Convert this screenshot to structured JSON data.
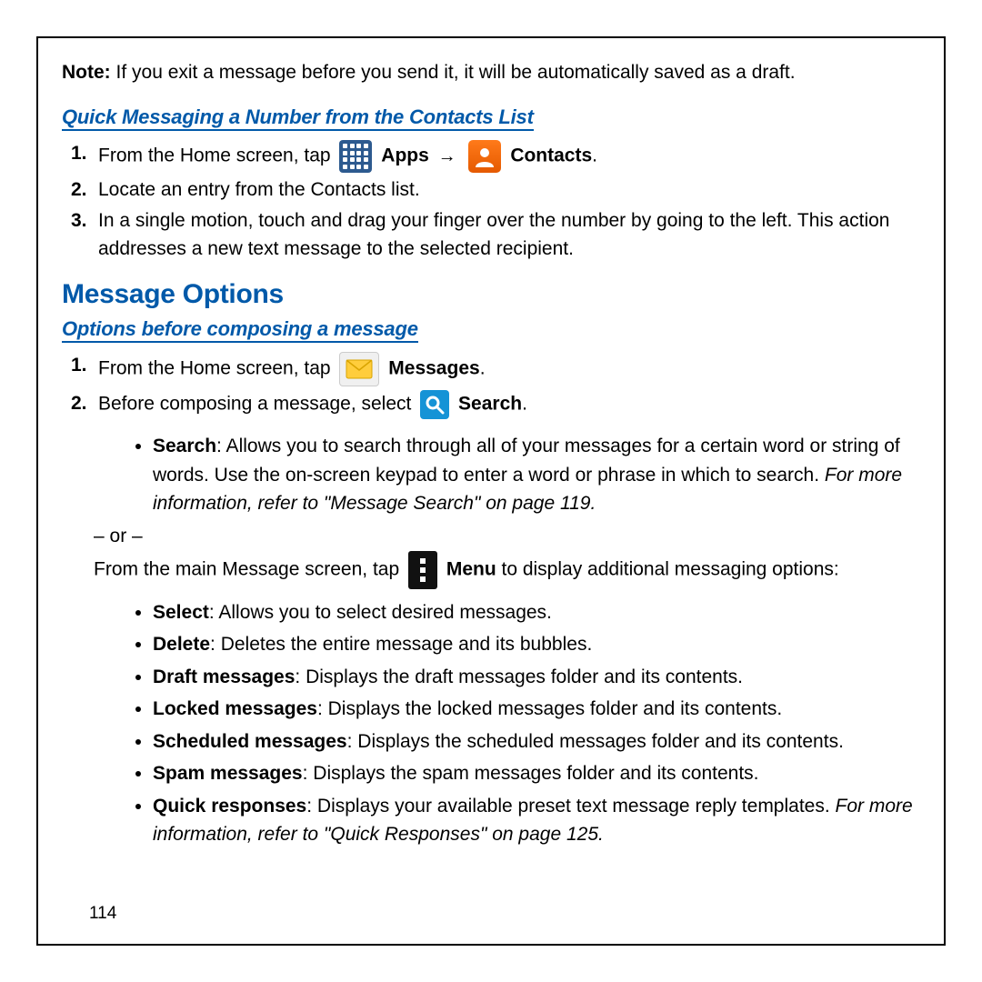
{
  "note": {
    "label": "Note:",
    "text": " If you exit a message before you send it, it will be automatically saved as a draft."
  },
  "section1": {
    "title": "Quick Messaging a Number from the Contacts List",
    "steps": {
      "s1_pre": "From the Home screen, tap ",
      "s1_apps": "Apps",
      "s1_contacts": "Contacts",
      "s1_period": ".",
      "s2": "Locate an entry from the Contacts list.",
      "s3": "In a single motion, touch and drag your finger over the number by going to the left. This action addresses a new text message to the selected recipient."
    }
  },
  "heading": "Message Options",
  "section2": {
    "title": "Options before composing a message",
    "s1_pre": "From the Home screen, tap ",
    "s1_msg": "Messages",
    "s1_period": ".",
    "s2_pre": "Before composing a message, select ",
    "s2_search": "Search",
    "s2_period": ".",
    "search_bullet": {
      "bold": "Search",
      "text": ": Allows you to search through all of your messages for a certain word or string of words. Use the on-screen keypad to enter a word or phrase in which to search. ",
      "italic": "For more information, refer to \"Message Search\" on page 119."
    },
    "or": "– or –",
    "menu_line_pre": "From the main Message screen, tap ",
    "menu_bold": "Menu",
    "menu_line_post": " to display additional messaging options:",
    "options": [
      {
        "bold": "Select",
        "text": ": Allows you to select desired messages."
      },
      {
        "bold": "Delete",
        "text": ": Deletes the entire message and its bubbles."
      },
      {
        "bold": "Draft messages",
        "text": ": Displays the draft messages folder and its contents."
      },
      {
        "bold": "Locked messages",
        "text": ": Displays the locked messages folder and its contents."
      },
      {
        "bold": "Scheduled messages",
        "text": ": Displays the scheduled messages folder and its contents."
      },
      {
        "bold": "Spam messages",
        "text": ": Displays the spam messages folder and its contents."
      },
      {
        "bold": "Quick responses",
        "text": ": Displays your available preset text message reply templates. ",
        "italic": "For more information, refer to \"Quick Responses\" on page 125."
      }
    ]
  },
  "page_number": "114"
}
